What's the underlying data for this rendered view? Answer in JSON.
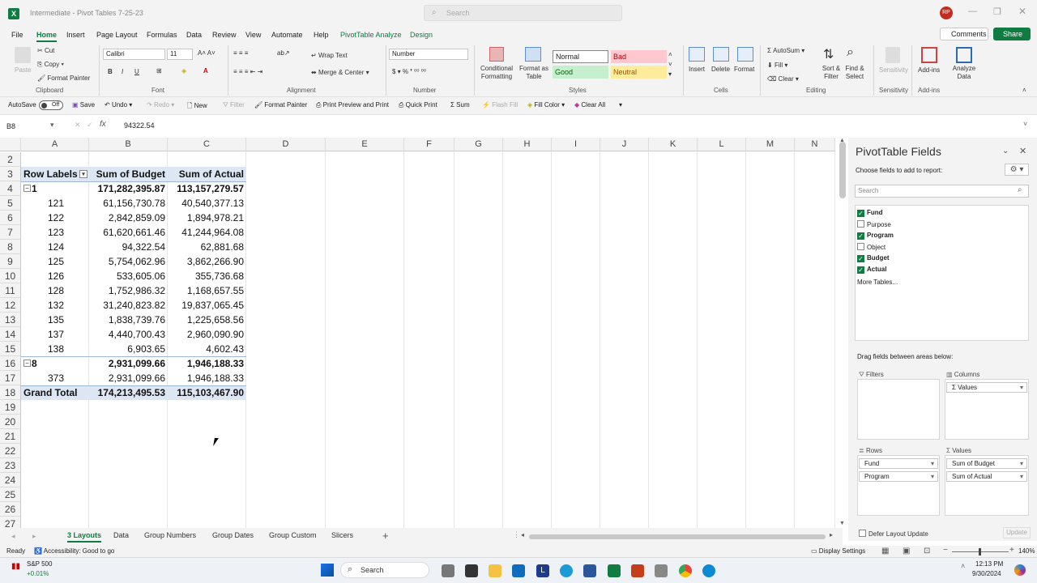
{
  "titlebar": {
    "title": "Intermediate - Pivot Tables 7-25-23",
    "search_placeholder": "Search",
    "avatar": "RP",
    "app_icon": "excel-icon"
  },
  "tabs": [
    "File",
    "Home",
    "Insert",
    "Page Layout",
    "Formulas",
    "Data",
    "Review",
    "View",
    "Automate",
    "Help",
    "PivotTable Analyze",
    "Design"
  ],
  "menu_right": {
    "comments": "Comments",
    "share": "Share"
  },
  "ribbon": {
    "clipboard": {
      "paste": "Paste",
      "cut": "Cut",
      "copy": "Copy",
      "format_painter": "Format Painter",
      "label": "Clipboard"
    },
    "font": {
      "name": "Calibri",
      "size": "11",
      "label": "Font"
    },
    "alignment": {
      "wrap": "Wrap Text",
      "merge": "Merge & Center",
      "label": "Alignment"
    },
    "number": {
      "format": "Number",
      "label": "Number"
    },
    "styles": {
      "conditional": "Conditional Formatting",
      "format_table": "Format as Table",
      "normal": "Normal",
      "bad": "Bad",
      "good": "Good",
      "neutral": "Neutral",
      "label": "Styles"
    },
    "cells": {
      "insert": "Insert",
      "delete": "Delete",
      "format": "Format",
      "label": "Cells"
    },
    "editing": {
      "autosum": "AutoSum",
      "fill": "Fill",
      "clear": "Clear",
      "sort": "Sort & Filter",
      "find": "Find & Select",
      "label": "Editing"
    },
    "sensitivity": {
      "btn": "Sensitivity",
      "label": "Sensitivity"
    },
    "addins": {
      "btn": "Add-ins",
      "label": "Add-ins",
      "analyze": "Analyze Data"
    }
  },
  "qat": {
    "autosave": "AutoSave",
    "toggle": "Off",
    "save": "Save",
    "undo": "Undo",
    "redo": "Redo",
    "new": "New",
    "filter": "Filter",
    "format_painter": "Format Painter",
    "print_preview": "Print Preview and Print",
    "quick_print": "Quick Print",
    "sum": "Sum",
    "flash_fill": "Flash Fill",
    "fill_color": "Fill Color",
    "clear_all": "Clear All"
  },
  "formula_bar": {
    "name_box": "B8",
    "fx": "fx",
    "value": "94322.54"
  },
  "columns": [
    "A",
    "B",
    "C",
    "D",
    "E",
    "F",
    "G",
    "H",
    "I",
    "J",
    "K",
    "L",
    "M",
    "N"
  ],
  "rows": [
    "2",
    "3",
    "4",
    "5",
    "6",
    "7",
    "8",
    "9",
    "10",
    "11",
    "12",
    "13",
    "14",
    "15",
    "16",
    "17",
    "18",
    "19",
    "20",
    "21",
    "22",
    "23",
    "24",
    "25",
    "26",
    "27"
  ],
  "pivot": {
    "headers": [
      "Row Labels",
      "Sum of Budget",
      "Sum of Actual"
    ],
    "data": [
      {
        "label": "1",
        "budget": "171,282,395.87",
        "actual": "113,157,279.57",
        "group": true
      },
      {
        "label": "121",
        "budget": "61,156,730.78",
        "actual": "40,540,377.13"
      },
      {
        "label": "122",
        "budget": "2,842,859.09",
        "actual": "1,894,978.21"
      },
      {
        "label": "123",
        "budget": "61,620,661.46",
        "actual": "41,244,964.08"
      },
      {
        "label": "124",
        "budget": "94,322.54",
        "actual": "62,881.68"
      },
      {
        "label": "125",
        "budget": "5,754,062.96",
        "actual": "3,862,266.90"
      },
      {
        "label": "126",
        "budget": "533,605.06",
        "actual": "355,736.68"
      },
      {
        "label": "128",
        "budget": "1,752,986.32",
        "actual": "1,168,657.55"
      },
      {
        "label": "132",
        "budget": "31,240,823.82",
        "actual": "19,837,065.45"
      },
      {
        "label": "135",
        "budget": "1,838,739.76",
        "actual": "1,225,658.56"
      },
      {
        "label": "137",
        "budget": "4,440,700.43",
        "actual": "2,960,090.90"
      },
      {
        "label": "138",
        "budget": "6,903.65",
        "actual": "4,602.43"
      },
      {
        "label": "8",
        "budget": "2,931,099.66",
        "actual": "1,946,188.33",
        "group": true
      },
      {
        "label": "373",
        "budget": "2,931,099.66",
        "actual": "1,946,188.33"
      }
    ],
    "total": {
      "label": "Grand Total",
      "budget": "174,213,495.53",
      "actual": "115,103,467.90"
    }
  },
  "pane": {
    "title": "PivotTable Fields",
    "subtitle": "Choose fields to add to report:",
    "search": "Search",
    "fields": [
      {
        "name": "Fund",
        "checked": true
      },
      {
        "name": "Purpose",
        "checked": false
      },
      {
        "name": "Program",
        "checked": true
      },
      {
        "name": "Object",
        "checked": false
      },
      {
        "name": "Budget",
        "checked": true
      },
      {
        "name": "Actual",
        "checked": true
      }
    ],
    "more": "More Tables...",
    "drag": "Drag fields between areas below:",
    "filters": "Filters",
    "columns": "Columns",
    "rows": "Rows",
    "values": "Values",
    "columns_items": [
      "Values"
    ],
    "rows_items": [
      "Fund",
      "Program"
    ],
    "values_items": [
      "Sum of Budget",
      "Sum of Actual"
    ],
    "defer": "Defer Layout Update",
    "update": "Update"
  },
  "sheets": [
    "3 Layouts",
    "Data",
    "Group Numbers",
    "Group Dates",
    "Group Custom",
    "Slicers"
  ],
  "status": {
    "ready": "Ready",
    "accessibility": "Accessibility: Good to go",
    "display": "Display Settings",
    "zoom": "140%"
  },
  "taskbar": {
    "stock_name": "S&P 500",
    "stock_change": "+0.01%",
    "search": "Search",
    "time": "12:13 PM",
    "date": "9/30/2024"
  },
  "colors": {
    "accent": "#107c41",
    "pivot_header": "#dde7f4"
  }
}
